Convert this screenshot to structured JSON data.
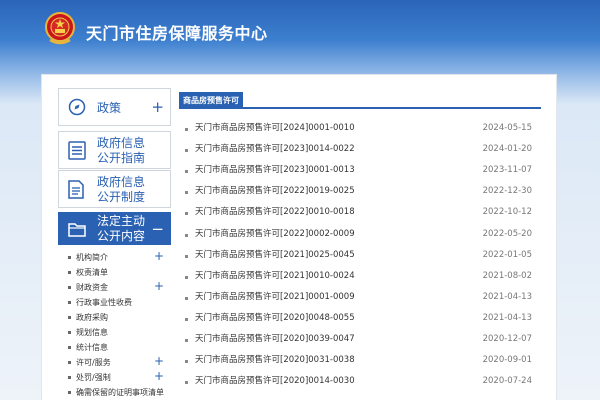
{
  "header": {
    "site_title": "天门市住房保障服务中心",
    "emblem_icon": "national-emblem-icon"
  },
  "sidebar": {
    "blocks": [
      {
        "label_lines": [
          "政策"
        ],
        "icon": "compass-icon",
        "has_plus": true,
        "active": false
      },
      {
        "label_lines": [
          "政府信息",
          "公开指南"
        ],
        "icon": "list-doc-icon",
        "has_plus": false,
        "active": false
      },
      {
        "label_lines": [
          "政府信息",
          "公开制度"
        ],
        "icon": "document-icon",
        "has_plus": false,
        "active": false
      },
      {
        "label_lines": [
          "法定主动",
          "公开内容"
        ],
        "icon": "folder-icon",
        "has_plus": false,
        "has_minus": true,
        "active": true
      }
    ],
    "plus_symbol": "+",
    "minus_symbol": "−",
    "sub_items": [
      {
        "label": "机构简介",
        "has_plus": true
      },
      {
        "label": "权责清单",
        "has_plus": false
      },
      {
        "label": "财政资金",
        "has_plus": true
      },
      {
        "label": "行政事业性收费",
        "has_plus": false
      },
      {
        "label": "政府采购",
        "has_plus": false
      },
      {
        "label": "规划信息",
        "has_plus": false
      },
      {
        "label": "统计信息",
        "has_plus": false
      },
      {
        "label": "许可/服务",
        "has_plus": true
      },
      {
        "label": "处罚/强制",
        "has_plus": true
      },
      {
        "label": "确需保留的证明事项清单",
        "has_plus": false
      }
    ]
  },
  "main": {
    "tab_label": "商品房预售许可",
    "rows": [
      {
        "title": "天门市商品房预售许可[2024]0001-0010",
        "date": "2024-05-15"
      },
      {
        "title": "天门市商品房预售许可[2023]0014-0022",
        "date": "2024-01-20"
      },
      {
        "title": "天门市商品房预售许可[2023]0001-0013",
        "date": "2023-11-07"
      },
      {
        "title": "天门市商品房预售许可[2022]0019-0025",
        "date": "2022-12-30"
      },
      {
        "title": "天门市商品房预售许可[2022]0010-0018",
        "date": "2022-10-12"
      },
      {
        "title": "天门市商品房预售许可[2022]0002-0009",
        "date": "2022-05-20"
      },
      {
        "title": "天门市商品房预售许可[2021]0025-0045",
        "date": "2022-01-05"
      },
      {
        "title": "天门市商品房预售许可[2021]0010-0024",
        "date": "2021-08-02"
      },
      {
        "title": "天门市商品房预售许可[2021]0001-0009",
        "date": "2021-04-13"
      },
      {
        "title": "天门市商品房预售许可[2020]0048-0055",
        "date": "2021-04-13"
      },
      {
        "title": "天门市商品房预售许可[2020]0039-0047",
        "date": "2020-12-07"
      },
      {
        "title": "天门市商品房预售许可[2020]0031-0038",
        "date": "2020-09-01"
      },
      {
        "title": "天门市商品房预售许可[2020]0014-0030",
        "date": "2020-07-24"
      }
    ]
  },
  "colors": {
    "accent": "#2b61b2",
    "header_top": "#2a64b8",
    "page_bg": "#eef3f9"
  }
}
